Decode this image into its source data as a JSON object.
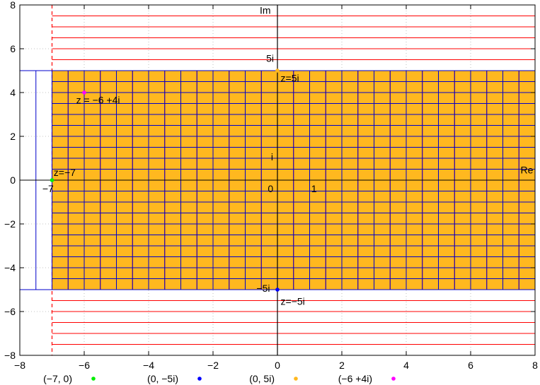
{
  "chart_data": {
    "type": "scatter",
    "title": "",
    "xlabel": "",
    "ylabel": "",
    "xlim": [
      -8,
      8
    ],
    "ylim": [
      -8,
      8
    ],
    "x_ticks": [
      -8,
      -6,
      -4,
      -2,
      0,
      2,
      4,
      6,
      8
    ],
    "y_ticks": [
      -8,
      -6,
      -4,
      -2,
      0,
      2,
      4,
      6,
      8
    ],
    "x_tick_labels": [
      "−8",
      "−6",
      "−4",
      "−2",
      "0",
      "2",
      "4",
      "6",
      "8"
    ],
    "y_tick_labels": [
      "−8",
      "−6",
      "−4",
      "−2",
      "0",
      "2",
      "4",
      "6",
      "8"
    ],
    "grid": true,
    "legend_placement": "bottom",
    "colors": {
      "fill": "#ffb81f",
      "red_lines": "#ff0000",
      "blue_lines": "#0000cc",
      "green_point": "#00ee00",
      "blue_point": "#0000ff",
      "orange_point": "#ffb81f",
      "magenta_point": "#ff00ff"
    },
    "shaded_region": {
      "x": [
        -7,
        8
      ],
      "y": [
        -5,
        5
      ]
    },
    "vertical_dashed_line_x": -7,
    "red_horizontal_lines_y": [
      -8,
      -7.5,
      -7,
      -6.5,
      -6,
      -5.5,
      5.5,
      6,
      6.5,
      7,
      7.5,
      8
    ],
    "red_vertical_lines_x": [
      -6.5,
      -6,
      -5.5,
      -5,
      -4.5,
      -4,
      -3.5,
      -3,
      -2.5,
      -2,
      -1.5,
      -1,
      -0.5,
      0.5,
      1,
      1.5,
      2,
      2.5,
      3,
      3.5,
      4,
      4.5,
      5,
      5.5,
      6,
      6.5,
      7,
      7.5
    ],
    "blue_horizontal_lines_y": [
      -5,
      -4.5,
      -4,
      -3.5,
      -3,
      -2.5,
      -2,
      -1.5,
      -1,
      -0.5,
      0.5,
      1,
      1.5,
      2,
      2.5,
      3,
      3.5,
      4,
      4.5,
      5
    ],
    "blue_vertical_lines_x": [
      -7.5,
      -7,
      -6.5,
      -6,
      -5.5,
      -5,
      -4.5,
      -4,
      -3.5,
      -3,
      -2.5,
      -2,
      -1.5,
      -1,
      -0.5,
      0.5,
      1,
      1.5,
      2,
      2.5,
      3,
      3.5,
      4,
      4.5,
      5,
      5.5,
      6,
      6.5,
      7,
      7.5
    ],
    "blue_left_segment_xs": [
      -8,
      -7.5
    ],
    "points": [
      {
        "x": -7,
        "y": 0,
        "color": "#00ee00"
      },
      {
        "x": 0,
        "y": -5,
        "color": "#0000ff"
      },
      {
        "x": 0,
        "y": 5,
        "color": "#ffb81f"
      },
      {
        "x": -6,
        "y": 4,
        "color": "#ff00ff"
      }
    ],
    "annotations": [
      {
        "text": "Im",
        "x": -0.55,
        "y": 7.6
      },
      {
        "text": "Re",
        "x": 7.55,
        "y": 0.3
      },
      {
        "text": "5i",
        "x": -0.35,
        "y": 5.4
      },
      {
        "text": "z=5i",
        "x": 0.1,
        "y": 4.5
      },
      {
        "text": "z = −6 +4i",
        "x": -6.25,
        "y": 3.5
      },
      {
        "text": "i",
        "x": -0.2,
        "y": 0.9
      },
      {
        "text": "z=−7",
        "x": -6.95,
        "y": 0.2
      },
      {
        "text": "−7",
        "x": -7.3,
        "y": -0.55
      },
      {
        "text": "0",
        "x": -0.3,
        "y": -0.55
      },
      {
        "text": "1",
        "x": 1.05,
        "y": -0.55
      },
      {
        "text": "−5i",
        "x": -0.65,
        "y": -5.1
      },
      {
        "text": "z=−5i",
        "x": 0.1,
        "y": -5.7
      }
    ],
    "legend": [
      {
        "label": "(−7, 0)",
        "color": "#00ee00"
      },
      {
        "label": "(0, −5i)",
        "color": "#0000ff"
      },
      {
        "label": "(0, 5i)",
        "color": "#ffb81f"
      },
      {
        "label": "(−6 +4i)",
        "color": "#ff00ff"
      }
    ]
  }
}
